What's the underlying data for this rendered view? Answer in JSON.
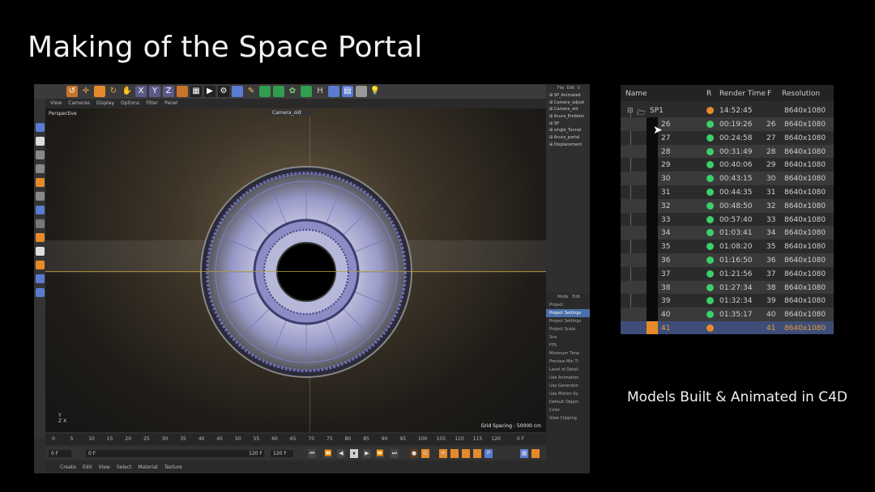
{
  "slide": {
    "title": "Making of the Space Portal",
    "caption": "Models Built & Animated in C4D"
  },
  "c4d": {
    "viewport_menu": [
      "View",
      "Cameras",
      "Display",
      "Options",
      "Filter",
      "Panel"
    ],
    "viewport_label": "Perspective",
    "camera_select": "Camera_old",
    "grid_spacing": "Grid Spacing : 50000 cm",
    "axis_labels": [
      "Y",
      "Z  X"
    ],
    "timeline_ticks": [
      "0",
      "5",
      "10",
      "15",
      "20",
      "25",
      "30",
      "35",
      "40",
      "45",
      "50",
      "55",
      "60",
      "65",
      "70",
      "75",
      "80",
      "85",
      "90",
      "95",
      "100",
      "105",
      "110",
      "115",
      "120"
    ],
    "timeline_end": "0 F",
    "transport": {
      "start": "0 F",
      "current": "0 F",
      "end": "120 F",
      "end2": "120 F"
    },
    "bottom_menu": [
      "Create",
      "Edit",
      "View",
      "Select",
      "Material",
      "Texture"
    ],
    "object_menu": [
      "File",
      "Edit",
      "V"
    ],
    "objects": [
      "SP_Animated",
      "Camera_adjust",
      "Camera_old",
      "Acura_Emblem",
      "SP",
      "single_Tunnel",
      "Acura_portal",
      "Displacement"
    ],
    "attr_menu": [
      "Mode",
      "Edit"
    ],
    "attr_items": [
      "Project",
      "Project Settings",
      "Project Settings",
      "Project Scale",
      "Sca",
      "FPS",
      "Minimum Time",
      "Preview Min Ti",
      "Level of Detail",
      "Use Animation",
      "Use Generator",
      "Use Motion Sy",
      "Default Object",
      "Color",
      "View Clipping"
    ]
  },
  "render_queue": {
    "headers": {
      "name": "Name",
      "r": "R",
      "render_time": "Render Time",
      "f": "F",
      "resolution": "Resolution"
    },
    "parent": {
      "name": "SP1",
      "time": "14:52:45",
      "resolution": "8640x1080",
      "status_color": "#e8892f"
    },
    "rows": [
      {
        "name": "26",
        "time": "00:19:26",
        "frame": "26",
        "resolution": "8640x1080"
      },
      {
        "name": "27",
        "time": "00:24:58",
        "frame": "27",
        "resolution": "8640x1080"
      },
      {
        "name": "28",
        "time": "00:31:49",
        "frame": "28",
        "resolution": "8640x1080"
      },
      {
        "name": "29",
        "time": "00:40:06",
        "frame": "29",
        "resolution": "8640x1080"
      },
      {
        "name": "30",
        "time": "00:43:15",
        "frame": "30",
        "resolution": "8640x1080"
      },
      {
        "name": "31",
        "time": "00:44:35",
        "frame": "31",
        "resolution": "8640x1080"
      },
      {
        "name": "32",
        "time": "00:48:50",
        "frame": "32",
        "resolution": "8640x1080"
      },
      {
        "name": "33",
        "time": "00:57:40",
        "frame": "33",
        "resolution": "8640x1080"
      },
      {
        "name": "34",
        "time": "01:03:41",
        "frame": "34",
        "resolution": "8640x1080"
      },
      {
        "name": "35",
        "time": "01:08:20",
        "frame": "35",
        "resolution": "8640x1080"
      },
      {
        "name": "36",
        "time": "01:16:50",
        "frame": "36",
        "resolution": "8640x1080"
      },
      {
        "name": "37",
        "time": "01:21:56",
        "frame": "37",
        "resolution": "8640x1080"
      },
      {
        "name": "38",
        "time": "01:27:34",
        "frame": "38",
        "resolution": "8640x1080"
      },
      {
        "name": "39",
        "time": "01:32:34",
        "frame": "39",
        "resolution": "8640x1080"
      },
      {
        "name": "40",
        "time": "01:35:17",
        "frame": "40",
        "resolution": "8640x1080"
      }
    ],
    "current": {
      "name": "41",
      "time": "",
      "frame": "41",
      "resolution": "8640x1080"
    },
    "colors": {
      "done": "#3ccf6a",
      "rendering": "#e8892f"
    }
  }
}
